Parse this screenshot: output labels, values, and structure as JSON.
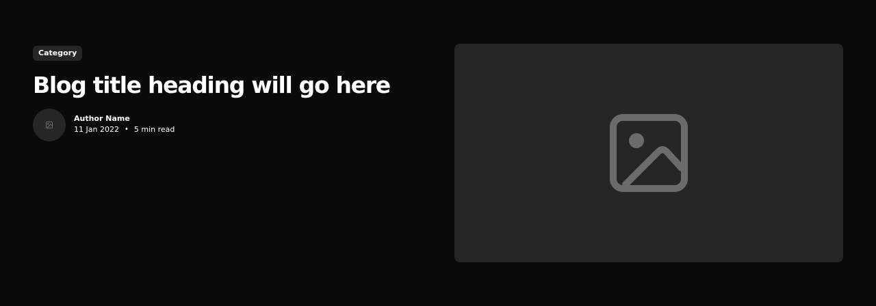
{
  "post": {
    "category": "Category",
    "title": "Blog title heading will go here",
    "author_name": "Author Name",
    "date": "11 Jan 2022",
    "separator": "•",
    "read_time": "5 min read"
  },
  "icons": {
    "avatar": "image-placeholder-icon",
    "hero": "image-placeholder-icon"
  },
  "colors": {
    "background": "#0a0a0a",
    "surface": "#262626",
    "text": "#ffffff",
    "placeholder_icon": "#6b6b6b"
  }
}
